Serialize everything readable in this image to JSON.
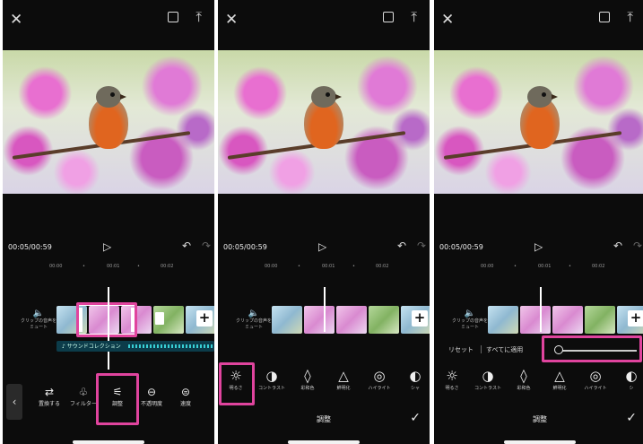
{
  "common": {
    "close_icon": "✕",
    "fullscreen_icon": "fullscreen",
    "export_icon": "⤒",
    "time": "00:05/00:59",
    "play_icon": "▷",
    "undo_icon": "↶",
    "redo_icon": "↷",
    "ruler_ticks": [
      "00:00",
      "•",
      "00:01",
      "•",
      "00:02"
    ],
    "mute_label": "クリップの音声をミュート",
    "mute_icon": "🔈",
    "add_clip": "+"
  },
  "panel1": {
    "audio_label": "♪ サウンドコレクション",
    "back_icon": "‹",
    "tools": [
      {
        "icon": "⇄",
        "label": "置換する"
      },
      {
        "icon": "♧",
        "label": "フィルター"
      },
      {
        "icon": "⚟",
        "label": "調整"
      },
      {
        "icon": "⊖",
        "label": "不透明度"
      },
      {
        "icon": "⊜",
        "label": "速度"
      }
    ]
  },
  "panel2": {
    "adjust_items": [
      {
        "icon": "☼",
        "label": "明るさ"
      },
      {
        "icon": "◑",
        "label": "コントラスト"
      },
      {
        "icon": "◊",
        "label": "彩和色"
      },
      {
        "icon": "△",
        "label": "鮮明化"
      },
      {
        "icon": "◎",
        "label": "ハイライト"
      },
      {
        "icon": "◐",
        "label": "シャ"
      }
    ],
    "footer_title": "調整",
    "check_icon": "✓"
  },
  "panel3": {
    "reset_label": "リセット",
    "apply_all_label": "すべてに適用",
    "slider_value": 0,
    "adjust_items": [
      {
        "icon": "☼",
        "label": "明るさ"
      },
      {
        "icon": "◑",
        "label": "コントラスト"
      },
      {
        "icon": "◊",
        "label": "彩和色"
      },
      {
        "icon": "△",
        "label": "鮮明化"
      },
      {
        "icon": "◎",
        "label": "ハイライト"
      },
      {
        "icon": "◐",
        "label": "シ"
      }
    ],
    "footer_title": "調整",
    "check_icon": "✓"
  },
  "colors": {
    "highlight": "#e0449e",
    "background": "#0c0c0c",
    "audio_wave": "#38d0d6"
  }
}
